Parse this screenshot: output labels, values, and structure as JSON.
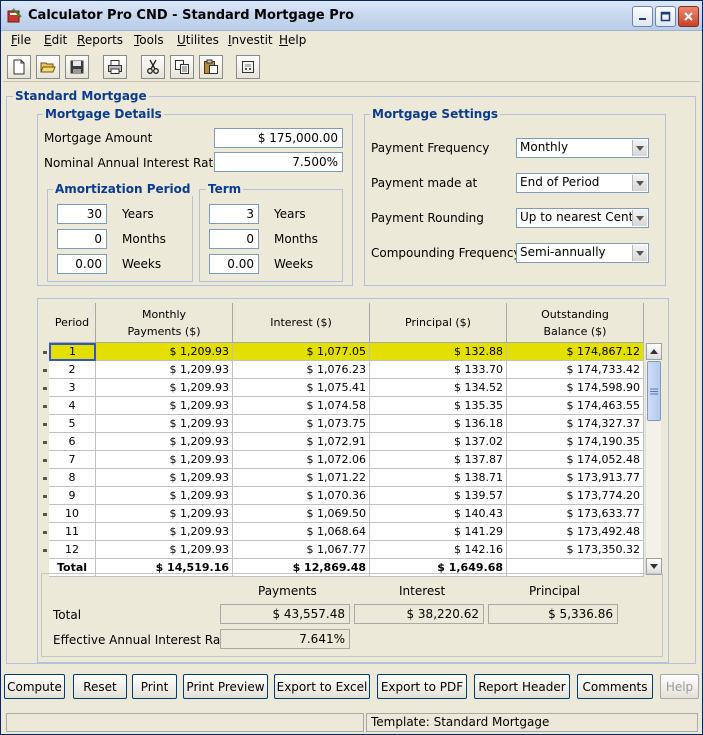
{
  "window": {
    "title": "Calculator Pro CND - Standard Mortgage Pro",
    "controls": [
      "minimize",
      "maximize",
      "close"
    ]
  },
  "menu": [
    {
      "label": "File",
      "mnemonic": "F",
      "rest": "ile"
    },
    {
      "label": "Edit",
      "mnemonic": "E",
      "rest": "dit"
    },
    {
      "label": "Reports",
      "mnemonic": "R",
      "rest": "eports"
    },
    {
      "label": "Tools",
      "mnemonic": "T",
      "rest": "ools"
    },
    {
      "label": "Utilites",
      "mnemonic": "U",
      "rest": "tilites"
    },
    {
      "label": "Investit",
      "mnemonic": "I",
      "rest": "nvestit"
    },
    {
      "label": "Help",
      "mnemonic": "H",
      "rest": "elp"
    }
  ],
  "toolbar": [
    "new-file-icon",
    "open-folder-icon",
    "save-icon",
    "print-icon",
    "cut-icon",
    "copy-icon",
    "paste-icon",
    "calculator-icon"
  ],
  "section_title": "Standard Mortgage",
  "details": {
    "title": "Mortgage Details",
    "amount_label": "Mortgage Amount",
    "amount_value": "$ 175,000.00",
    "rate_label": "Nominal Annual Interest Rate",
    "rate_value": "7.500%"
  },
  "amortization": {
    "title": "Amortization Period",
    "years": "30",
    "years_label": "Years",
    "months": "0",
    "months_label": "Months",
    "weeks": "0.00",
    "weeks_label": "Weeks"
  },
  "term": {
    "title": "Term",
    "years": "3",
    "years_label": "Years",
    "months": "0",
    "months_label": "Months",
    "weeks": "0.00",
    "weeks_label": "Weeks"
  },
  "settings": {
    "title": "Mortgage Settings",
    "frequency_label": "Payment Frequency",
    "frequency_value": "Monthly",
    "made_at_label": "Payment made at",
    "made_at_value": "End of Period",
    "rounding_label": "Payment Rounding",
    "rounding_value": "Up to nearest Cent",
    "compounding_label": "Compounding Frequency",
    "compounding_value": "Semi-annually"
  },
  "table": {
    "headers": [
      "Period",
      "Monthly\nPayments ($)",
      "Interest ($)",
      "Principal ($)",
      "Outstanding\nBalance ($)"
    ],
    "rows": [
      [
        "1",
        "$ 1,209.93",
        "$ 1,077.05",
        "$ 132.88",
        "$ 174,867.12"
      ],
      [
        "2",
        "$ 1,209.93",
        "$ 1,076.23",
        "$ 133.70",
        "$ 174,733.42"
      ],
      [
        "3",
        "$ 1,209.93",
        "$ 1,075.41",
        "$ 134.52",
        "$ 174,598.90"
      ],
      [
        "4",
        "$ 1,209.93",
        "$ 1,074.58",
        "$ 135.35",
        "$ 174,463.55"
      ],
      [
        "5",
        "$ 1,209.93",
        "$ 1,073.75",
        "$ 136.18",
        "$ 174,327.37"
      ],
      [
        "6",
        "$ 1,209.93",
        "$ 1,072.91",
        "$ 137.02",
        "$ 174,190.35"
      ],
      [
        "7",
        "$ 1,209.93",
        "$ 1,072.06",
        "$ 137.87",
        "$ 174,052.48"
      ],
      [
        "8",
        "$ 1,209.93",
        "$ 1,071.22",
        "$ 138.71",
        "$ 173,913.77"
      ],
      [
        "9",
        "$ 1,209.93",
        "$ 1,070.36",
        "$ 139.57",
        "$ 173,774.20"
      ],
      [
        "10",
        "$ 1,209.93",
        "$ 1,069.50",
        "$ 140.43",
        "$ 173,633.77"
      ],
      [
        "11",
        "$ 1,209.93",
        "$ 1,068.64",
        "$ 141.29",
        "$ 173,492.48"
      ],
      [
        "12",
        "$ 1,209.93",
        "$ 1,067.77",
        "$ 142.16",
        "$ 173,350.32"
      ]
    ],
    "total_row": [
      "Total",
      "$ 14,519.16",
      "$ 12,869.48",
      "$ 1,649.68",
      ""
    ],
    "selected_row": 1,
    "highlight_color": "#e3e000"
  },
  "summary": {
    "payments_label": "Payments",
    "interest_label": "Interest",
    "principal_label": "Principal",
    "total_label": "Total",
    "total_payments": "$ 43,557.48",
    "total_interest": "$ 38,220.62",
    "total_principal": "$ 5,336.86",
    "effective_label": "Effective Annual Interest Rate",
    "effective_value": "7.641%"
  },
  "buttons": {
    "compute": "Compute",
    "reset": "Reset",
    "print": "Print",
    "print_preview": "Print Preview",
    "export_excel": "Export to Excel",
    "export_pdf": "Export to PDF",
    "report_header": "Report Header",
    "comments": "Comments",
    "help": "Help"
  },
  "status": {
    "left": "",
    "template": "Template: Standard Mortgage"
  }
}
